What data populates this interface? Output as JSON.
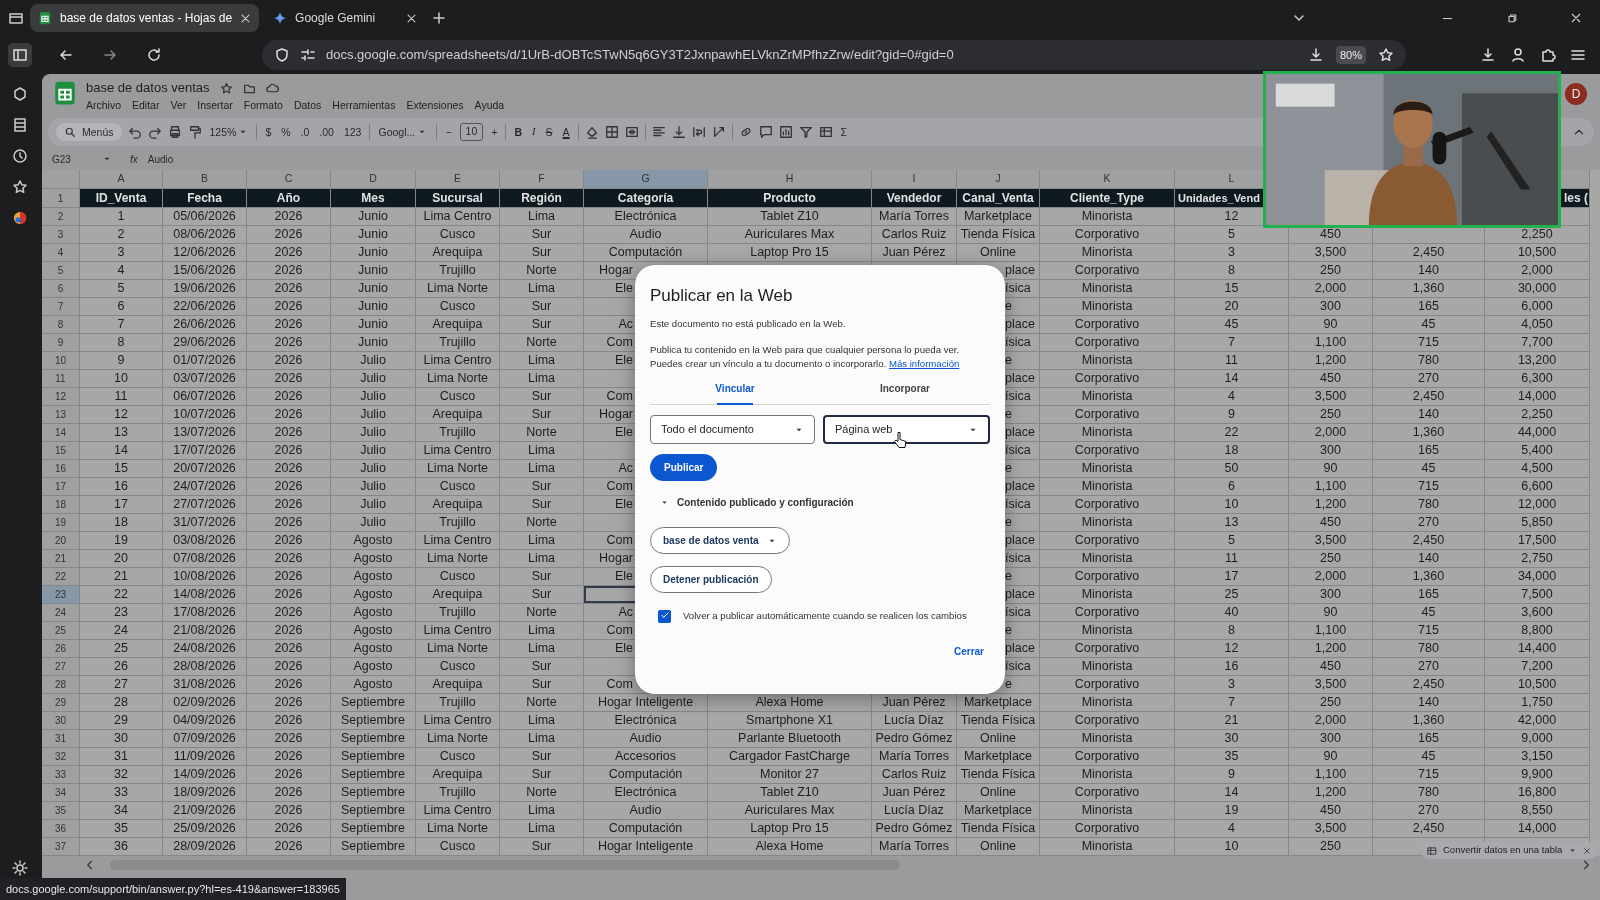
{
  "browser": {
    "tabs": [
      {
        "title": "base de datos ventas - Hojas de",
        "selected": true
      },
      {
        "title": "Google Gemini",
        "selected": false
      }
    ],
    "url": "docs.google.com/spreadsheets/d/1UrB-dOBTcSTwN5q6GY3T2JxnpawhELVknZrMPfhzZrw/edit?gid=0#gid=0",
    "zoom": "80%",
    "status_link": "docs.google.com/support/bin/answer.py?hl=es-419&answer=183965"
  },
  "document": {
    "title": "base de datos ventas",
    "avatar": "D",
    "menu": [
      "Archivo",
      "Editar",
      "Ver",
      "Insertar",
      "Formato",
      "Datos",
      "Herramientas",
      "Extensiones",
      "Ayuda"
    ]
  },
  "toolbar": {
    "search": "Menús",
    "zoom": "125%",
    "currency": "$",
    "percent": "%",
    "decrease_decimals": ".0",
    "increase_decimals": ".00",
    "number_format": "123",
    "font": "Googl...",
    "size_minus": "−",
    "font_size": "10",
    "size_plus": "+",
    "bold": "B",
    "italic": "I",
    "strikethrough": "S",
    "text_color": "A",
    "functions": "Σ"
  },
  "formula_bar": {
    "cell": "G23",
    "fx": "fx",
    "value": "Audio"
  },
  "sheet": {
    "columns": [
      {
        "letter": "A",
        "selected": false
      },
      {
        "letter": "B",
        "selected": false
      },
      {
        "letter": "C",
        "selected": false
      },
      {
        "letter": "D",
        "selected": false
      },
      {
        "letter": "E",
        "selected": false
      },
      {
        "letter": "F",
        "selected": false
      },
      {
        "letter": "G",
        "selected": true
      },
      {
        "letter": "H",
        "selected": false
      },
      {
        "letter": "I",
        "selected": false
      },
      {
        "letter": "J",
        "selected": false
      },
      {
        "letter": "K",
        "selected": false
      },
      {
        "letter": "L",
        "selected": false
      }
    ],
    "header_row": {
      "number": "1",
      "cells": [
        "ID_Venta",
        "Fecha",
        "Año",
        "Mes",
        "Sucursal",
        "Región",
        "Categoría",
        "Producto",
        "Vendedor",
        "Canal_Venta",
        "Cliente_Type",
        "Unidades_Vend",
        null,
        null,
        "les ("
      ]
    },
    "rows": [
      {
        "number": "2",
        "selected": false,
        "behind_dialog": false,
        "cells": [
          "1",
          "05/06/2026",
          "2026",
          "Junio",
          "Lima Centro",
          "Lima",
          "Electrónica",
          "Tablet Z10",
          "María Torres",
          "Marketplace",
          "Minorista",
          "12",
          null,
          null,
          null
        ]
      },
      {
        "number": "3",
        "selected": false,
        "behind_dialog": false,
        "cells": [
          "2",
          "08/06/2026",
          "2026",
          "Junio",
          "Cusco",
          "Sur",
          "Audio",
          "Auriculares Max",
          "Carlos Ruiz",
          "Tienda Física",
          "Corporativo",
          "5",
          "450",
          null,
          "2,250"
        ]
      },
      {
        "number": "4",
        "selected": false,
        "behind_dialog": false,
        "cells": [
          "3",
          "12/06/2026",
          "2026",
          "Junio",
          "Arequipa",
          "Sur",
          "Computación",
          "Laptop Pro 15",
          "Juan Pérez",
          "Online",
          "Minorista",
          "3",
          "3,500",
          "2,450",
          "10,500"
        ]
      },
      {
        "number": "5",
        "selected": false,
        "behind_dialog": true,
        "cells": [
          "4",
          "15/06/2026",
          "2026",
          "Junio",
          "Trujillo",
          "Norte",
          "Hogar",
          null,
          null,
          "place",
          "Corporativo",
          "8",
          "250",
          "140",
          "2,000"
        ]
      },
      {
        "number": "6",
        "selected": false,
        "behind_dialog": true,
        "cells": [
          "5",
          "19/06/2026",
          "2026",
          "Junio",
          "Lima Norte",
          "Lima",
          "Ele",
          null,
          null,
          "ísica",
          "Minorista",
          "15",
          "2,000",
          "1,360",
          "30,000"
        ]
      },
      {
        "number": "7",
        "selected": false,
        "behind_dialog": true,
        "cells": [
          "6",
          "22/06/2026",
          "2026",
          "Junio",
          "Cusco",
          "Sur",
          null,
          null,
          null,
          "e",
          "Minorista",
          "20",
          "300",
          "165",
          "6,000"
        ]
      },
      {
        "number": "8",
        "selected": false,
        "behind_dialog": true,
        "cells": [
          "7",
          "26/06/2026",
          "2026",
          "Junio",
          "Arequipa",
          "Sur",
          "Ac",
          null,
          null,
          "place",
          "Corporativo",
          "45",
          "90",
          "45",
          "4,050"
        ]
      },
      {
        "number": "9",
        "selected": false,
        "behind_dialog": true,
        "cells": [
          "8",
          "29/06/2026",
          "2026",
          "Junio",
          "Trujillo",
          "Norte",
          "Com",
          null,
          null,
          "ísica",
          "Corporativo",
          "7",
          "1,100",
          "715",
          "7,700"
        ]
      },
      {
        "number": "10",
        "selected": false,
        "behind_dialog": true,
        "cells": [
          "9",
          "01/07/2026",
          "2026",
          "Julio",
          "Lima Centro",
          "Lima",
          "Ele",
          null,
          null,
          "e",
          "Minorista",
          "11",
          "1,200",
          "780",
          "13,200"
        ]
      },
      {
        "number": "11",
        "selected": false,
        "behind_dialog": true,
        "cells": [
          "10",
          "03/07/2026",
          "2026",
          "Julio",
          "Lima Norte",
          "Lima",
          null,
          null,
          null,
          "place",
          "Corporativo",
          "14",
          "450",
          "270",
          "6,300"
        ]
      },
      {
        "number": "12",
        "selected": false,
        "behind_dialog": true,
        "cells": [
          "11",
          "06/07/2026",
          "2026",
          "Julio",
          "Cusco",
          "Sur",
          "Com",
          null,
          null,
          "ísica",
          "Minorista",
          "4",
          "3,500",
          "2,450",
          "14,000"
        ]
      },
      {
        "number": "13",
        "selected": false,
        "behind_dialog": true,
        "cells": [
          "12",
          "10/07/2026",
          "2026",
          "Julio",
          "Arequipa",
          "Sur",
          "Hogar",
          null,
          null,
          "e",
          "Corporativo",
          "9",
          "250",
          "140",
          "2,250"
        ]
      },
      {
        "number": "14",
        "selected": false,
        "behind_dialog": true,
        "cells": [
          "13",
          "13/07/2026",
          "2026",
          "Julio",
          "Trujillo",
          "Norte",
          "Ele",
          null,
          null,
          "place",
          "Minorista",
          "22",
          "2,000",
          "1,360",
          "44,000"
        ]
      },
      {
        "number": "15",
        "selected": false,
        "behind_dialog": true,
        "cells": [
          "14",
          "17/07/2026",
          "2026",
          "Julio",
          "Lima Centro",
          "Lima",
          null,
          null,
          null,
          "ísica",
          "Corporativo",
          "18",
          "300",
          "165",
          "5,400"
        ]
      },
      {
        "number": "16",
        "selected": false,
        "behind_dialog": true,
        "cells": [
          "15",
          "20/07/2026",
          "2026",
          "Julio",
          "Lima Norte",
          "Lima",
          "Ac",
          null,
          null,
          "e",
          "Minorista",
          "50",
          "90",
          "45",
          "4,500"
        ]
      },
      {
        "number": "17",
        "selected": false,
        "behind_dialog": true,
        "cells": [
          "16",
          "24/07/2026",
          "2026",
          "Julio",
          "Cusco",
          "Sur",
          "Com",
          null,
          null,
          "place",
          "Minorista",
          "6",
          "1,100",
          "715",
          "6,600"
        ]
      },
      {
        "number": "18",
        "selected": false,
        "behind_dialog": true,
        "cells": [
          "17",
          "27/07/2026",
          "2026",
          "Julio",
          "Arequipa",
          "Sur",
          "Ele",
          null,
          null,
          "ísica",
          "Corporativo",
          "10",
          "1,200",
          "780",
          "12,000"
        ]
      },
      {
        "number": "19",
        "selected": false,
        "behind_dialog": true,
        "cells": [
          "18",
          "31/07/2026",
          "2026",
          "Julio",
          "Trujillo",
          "Norte",
          null,
          null,
          null,
          "e",
          "Minorista",
          "13",
          "450",
          "270",
          "5,850"
        ]
      },
      {
        "number": "20",
        "selected": false,
        "behind_dialog": true,
        "cells": [
          "19",
          "03/08/2026",
          "2026",
          "Agosto",
          "Lima Centro",
          "Lima",
          "Com",
          null,
          null,
          "place",
          "Corporativo",
          "5",
          "3,500",
          "2,450",
          "17,500"
        ]
      },
      {
        "number": "21",
        "selected": false,
        "behind_dialog": true,
        "cells": [
          "20",
          "07/08/2026",
          "2026",
          "Agosto",
          "Lima Norte",
          "Lima",
          "Hogar",
          null,
          null,
          "ísica",
          "Minorista",
          "11",
          "250",
          "140",
          "2,750"
        ]
      },
      {
        "number": "22",
        "selected": false,
        "behind_dialog": true,
        "cells": [
          "21",
          "10/08/2026",
          "2026",
          "Agosto",
          "Cusco",
          "Sur",
          "Ele",
          null,
          null,
          "e",
          "Corporativo",
          "17",
          "2,000",
          "1,360",
          "34,000"
        ]
      },
      {
        "number": "23",
        "selected": true,
        "behind_dialog": true,
        "cells": [
          "22",
          "14/08/2026",
          "2026",
          "Agosto",
          "Arequipa",
          "Sur",
          null,
          null,
          null,
          "place",
          "Minorista",
          "25",
          "300",
          "165",
          "7,500"
        ]
      },
      {
        "number": "24",
        "selected": false,
        "behind_dialog": true,
        "cells": [
          "23",
          "17/08/2026",
          "2026",
          "Agosto",
          "Trujillo",
          "Norte",
          "Ac",
          null,
          null,
          "ísica",
          "Corporativo",
          "40",
          "90",
          "45",
          "3,600"
        ]
      },
      {
        "number": "25",
        "selected": false,
        "behind_dialog": true,
        "cells": [
          "24",
          "21/08/2026",
          "2026",
          "Agosto",
          "Lima Centro",
          "Lima",
          "Com",
          null,
          null,
          "e",
          "Minorista",
          "8",
          "1,100",
          "715",
          "8,800"
        ]
      },
      {
        "number": "26",
        "selected": false,
        "behind_dialog": true,
        "cells": [
          "25",
          "24/08/2026",
          "2026",
          "Agosto",
          "Lima Norte",
          "Lima",
          "Ele",
          null,
          null,
          "place",
          "Corporativo",
          "12",
          "1,200",
          "780",
          "14,400"
        ]
      },
      {
        "number": "27",
        "selected": false,
        "behind_dialog": true,
        "cells": [
          "26",
          "28/08/2026",
          "2026",
          "Agosto",
          "Cusco",
          "Sur",
          null,
          null,
          null,
          "ísica",
          "Minorista",
          "16",
          "450",
          "270",
          "7,200"
        ]
      },
      {
        "number": "28",
        "selected": false,
        "behind_dialog": true,
        "cells": [
          "27",
          "31/08/2026",
          "2026",
          "Agosto",
          "Arequipa",
          "Sur",
          "Com",
          null,
          null,
          "e",
          "Corporativo",
          "3",
          "3,500",
          "2,450",
          "10,500"
        ]
      },
      {
        "number": "29",
        "selected": false,
        "behind_dialog": false,
        "cells": [
          "28",
          "02/09/2026",
          "2026",
          "Septiembre",
          "Trujillo",
          "Norte",
          "Hogar Inteligente",
          "Alexa Home",
          "Juan Pérez",
          "Marketplace",
          "Minorista",
          "7",
          "250",
          "140",
          "1,750"
        ]
      },
      {
        "number": "30",
        "selected": false,
        "behind_dialog": false,
        "cells": [
          "29",
          "04/09/2026",
          "2026",
          "Septiembre",
          "Lima Centro",
          "Lima",
          "Electrónica",
          "Smartphone X1",
          "Lucía Díaz",
          "Tienda Física",
          "Corporativo",
          "21",
          "2,000",
          "1,360",
          "42,000"
        ]
      },
      {
        "number": "31",
        "selected": false,
        "behind_dialog": false,
        "cells": [
          "30",
          "07/09/2026",
          "2026",
          "Septiembre",
          "Lima Norte",
          "Lima",
          "Audio",
          "Parlante Bluetooth",
          "Pedro Gómez",
          "Online",
          "Minorista",
          "30",
          "300",
          "165",
          "9,000"
        ]
      },
      {
        "number": "32",
        "selected": false,
        "behind_dialog": false,
        "cells": [
          "31",
          "11/09/2026",
          "2026",
          "Septiembre",
          "Cusco",
          "Sur",
          "Accesorios",
          "Cargador FastCharge",
          "María Torres",
          "Marketplace",
          "Corporativo",
          "35",
          "90",
          "45",
          "3,150"
        ]
      },
      {
        "number": "33",
        "selected": false,
        "behind_dialog": false,
        "cells": [
          "32",
          "14/09/2026",
          "2026",
          "Septiembre",
          "Arequipa",
          "Sur",
          "Computación",
          "Monitor 27",
          "Carlos Ruiz",
          "Tienda Física",
          "Minorista",
          "9",
          "1,100",
          "715",
          "9,900"
        ]
      },
      {
        "number": "34",
        "selected": false,
        "behind_dialog": false,
        "cells": [
          "33",
          "18/09/2026",
          "2026",
          "Septiembre",
          "Trujillo",
          "Norte",
          "Electrónica",
          "Tablet Z10",
          "Juan Pérez",
          "Online",
          "Corporativo",
          "14",
          "1,200",
          "780",
          "16,800"
        ]
      },
      {
        "number": "35",
        "selected": false,
        "behind_dialog": false,
        "cells": [
          "34",
          "21/09/2026",
          "2026",
          "Septiembre",
          "Lima Centro",
          "Lima",
          "Audio",
          "Auriculares Max",
          "Lucía Díaz",
          "Marketplace",
          "Minorista",
          "19",
          "450",
          "270",
          "8,550"
        ]
      },
      {
        "number": "36",
        "selected": false,
        "behind_dialog": false,
        "cells": [
          "35",
          "25/09/2026",
          "2026",
          "Septiembre",
          "Lima Norte",
          "Lima",
          "Computación",
          "Laptop Pro 15",
          "Pedro Gómez",
          "Tienda Física",
          "Corporativo",
          "4",
          "3,500",
          "2,450",
          "14,000"
        ]
      },
      {
        "number": "37",
        "selected": false,
        "behind_dialog": false,
        "cells": [
          "36",
          "28/09/2026",
          "2026",
          "Septiembre",
          "Cusco",
          "Sur",
          "Hogar Inteligente",
          "Alexa Home",
          "María Torres",
          "Online",
          "Minorista",
          "10",
          "250",
          null,
          null
        ]
      }
    ]
  },
  "convert_chip": {
    "label": "Convertir datos en una tabla"
  },
  "dialog": {
    "title": "Publicar en la Web",
    "status": "Este documento no está publicado en la Web.",
    "description": "Publica tu contenido en la Web para que cualquier persona lo pueda ver. Puedes crear un vínculo a tu documento o incorporarlo.",
    "link": "Más información",
    "tabs": [
      {
        "label": "Vincular",
        "selected": true
      },
      {
        "label": "Incorporar",
        "selected": false
      }
    ],
    "selects": [
      {
        "value": "Todo el documento",
        "focused": false
      },
      {
        "value": "Página web",
        "focused": true
      }
    ],
    "publish_button": "Publicar",
    "section": {
      "label": "Contenido publicado y configuración",
      "expanded": true
    },
    "sheet_select": "base de datos venta",
    "stop_button": "Detener publicación",
    "auto_republish": {
      "label": "Volver a publicar automáticamente cuando se realicen los cambios",
      "checked": true
    },
    "close_button": "Cerrar"
  }
}
